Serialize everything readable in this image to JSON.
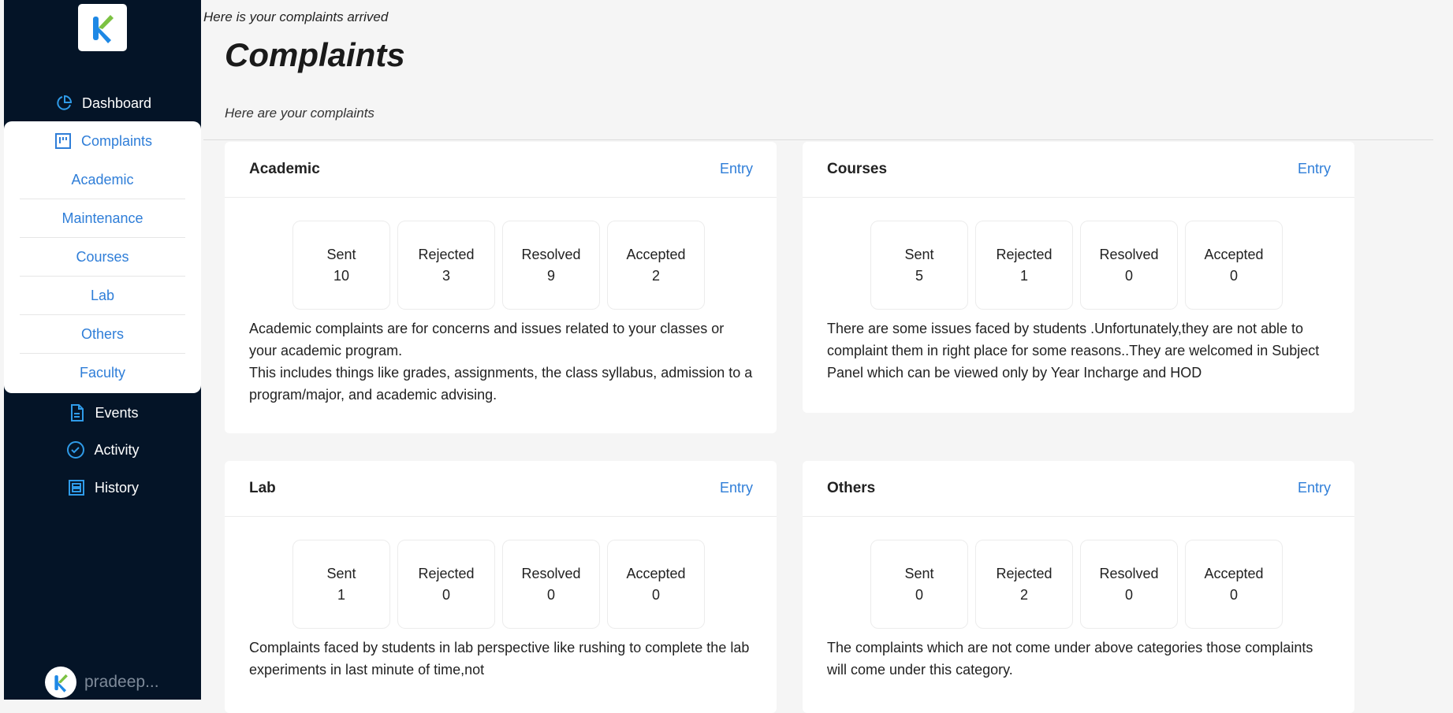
{
  "sidebar": {
    "items_top": [
      {
        "label": "Dashboard",
        "icon": "pie-chart-icon"
      }
    ],
    "complaints_head": {
      "label": "Complaints",
      "icon": "kanban-icon"
    },
    "sub_items": [
      "Academic",
      "Maintenance",
      "Courses",
      "Lab",
      "Others",
      "Faculty"
    ],
    "items_bottom": [
      {
        "label": "Events",
        "icon": "document-icon"
      },
      {
        "label": "Activity",
        "icon": "check-circle-icon"
      },
      {
        "label": "History",
        "icon": "archive-icon"
      }
    ],
    "user": {
      "name": "pradeep..."
    }
  },
  "main": {
    "notice": "Here is your complaints arrived",
    "title": "Complaints",
    "subtitle": "Here are your complaints"
  },
  "cards": [
    {
      "title": "Academic",
      "entry": "Entry",
      "stats": [
        {
          "label": "Sent",
          "value": "10"
        },
        {
          "label": "Rejected",
          "value": "3"
        },
        {
          "label": "Resolved",
          "value": "9"
        },
        {
          "label": "Accepted",
          "value": "2"
        }
      ],
      "description": "Academic complaints are for concerns and issues related to your classes or your academic program.\nThis includes things like grades, assignments, the class syllabus, admission to a program/major, and academic advising."
    },
    {
      "title": "Courses",
      "entry": "Entry",
      "stats": [
        {
          "label": "Sent",
          "value": "5"
        },
        {
          "label": "Rejected",
          "value": "1"
        },
        {
          "label": "Resolved",
          "value": "0"
        },
        {
          "label": "Accepted",
          "value": "0"
        }
      ],
      "description": "There are some issues faced by students .Unfortunately,they are not able to complaint them in right place for some reasons..They are welcomed in Subject Panel which can be viewed only by Year Incharge and HOD"
    },
    {
      "title": "Lab",
      "entry": "Entry",
      "stats": [
        {
          "label": "Sent",
          "value": "1"
        },
        {
          "label": "Rejected",
          "value": "0"
        },
        {
          "label": "Resolved",
          "value": "0"
        },
        {
          "label": "Accepted",
          "value": "0"
        }
      ],
      "description": "Complaints faced by students in lab perspective like rushing to complete the lab experiments in last minute of time,not"
    },
    {
      "title": "Others",
      "entry": "Entry",
      "stats": [
        {
          "label": "Sent",
          "value": "0"
        },
        {
          "label": "Rejected",
          "value": "2"
        },
        {
          "label": "Resolved",
          "value": "0"
        },
        {
          "label": "Accepted",
          "value": "0"
        }
      ],
      "description": "The complaints which are not come under above categories those complaints will come under this category."
    }
  ],
  "colors": {
    "sidebar_bg": "#041427",
    "accent": "#2f7ed8",
    "logo_blue": "#1e88e5",
    "logo_green": "#7cc242"
  }
}
